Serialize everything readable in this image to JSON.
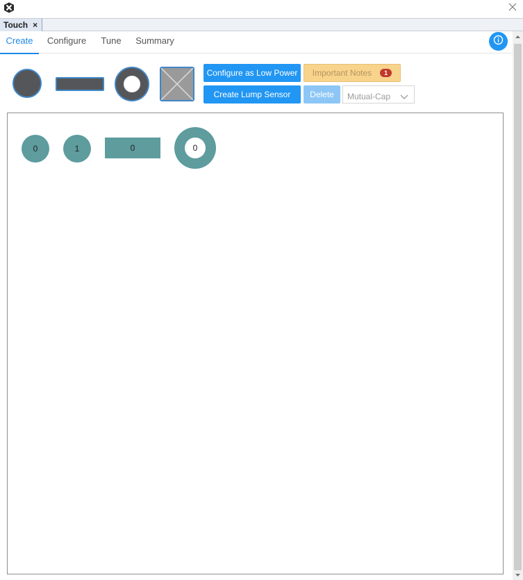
{
  "window": {
    "logo_icon": "xc-logo-icon",
    "close_icon": "close-icon"
  },
  "editor_tab": {
    "label": "Touch",
    "close": "×"
  },
  "nav": {
    "tabs": [
      {
        "label": "Create",
        "active": true
      },
      {
        "label": "Configure",
        "active": false
      },
      {
        "label": "Tune",
        "active": false
      },
      {
        "label": "Summary",
        "active": false
      }
    ],
    "info_icon": "info-icon"
  },
  "palette": {
    "button_icon": "button-sensor-icon",
    "slider_icon": "slider-sensor-icon",
    "wheel_icon": "wheel-sensor-icon",
    "surface_icon": "surface-sensor-icon"
  },
  "actions": {
    "low_power_label": "Configure as Low Power",
    "lump_label": "Create Lump Sensor",
    "notes_label": "Important Notes",
    "notes_count": "1",
    "delete_label": "Delete",
    "mode_value": "Mutual-Cap"
  },
  "canvas": {
    "sensors": [
      {
        "type": "button",
        "label": "0"
      },
      {
        "type": "button",
        "label": "1"
      },
      {
        "type": "slider",
        "label": "0"
      },
      {
        "type": "wheel",
        "label": "0"
      }
    ]
  },
  "colors": {
    "accent": "#2196f3",
    "sensor_fill": "#5e9c9e",
    "palette_fill": "#555659",
    "notes_bg": "#f8d38b",
    "badge_red": "#c0392b"
  }
}
